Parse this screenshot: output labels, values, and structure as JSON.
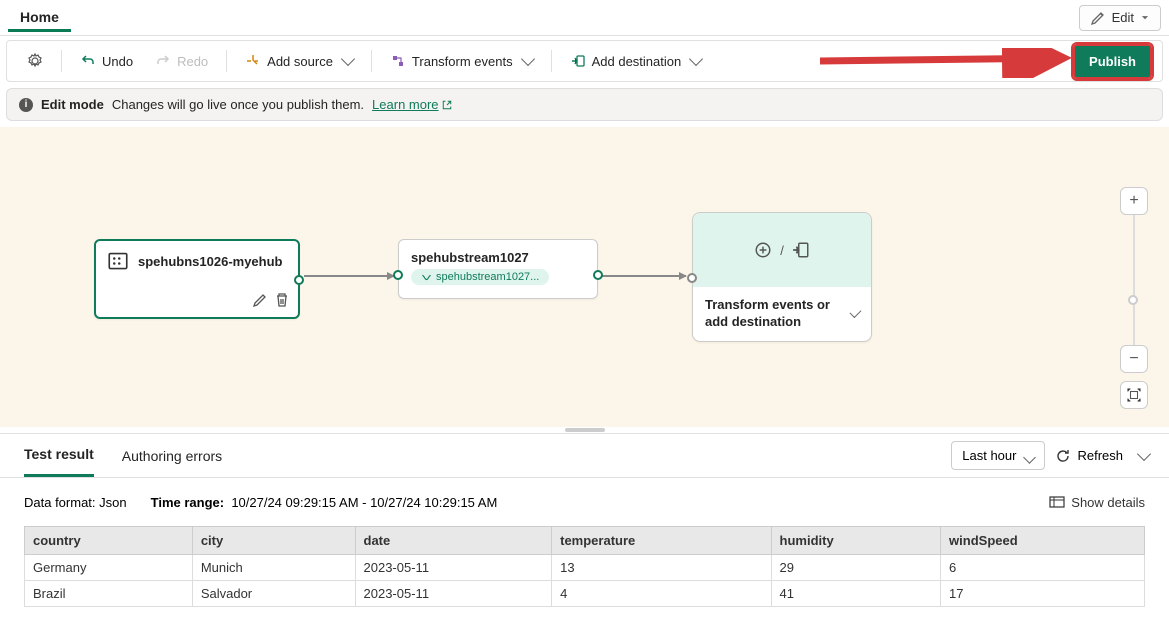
{
  "header": {
    "tab": "Home",
    "edit_label": "Edit"
  },
  "toolbar": {
    "undo": "Undo",
    "redo": "Redo",
    "add_source": "Add source",
    "transform": "Transform events",
    "add_dest": "Add destination",
    "publish": "Publish"
  },
  "edit_mode": {
    "title": "Edit mode",
    "msg": "Changes will go live once you publish them.",
    "learn": "Learn more"
  },
  "nodes": {
    "source_title": "spehubns1026-myehub",
    "stream_title": "spehubstream1027",
    "stream_pill": "spehubstream1027...",
    "dest_text": "Transform events or add destination"
  },
  "results": {
    "tab_test": "Test result",
    "tab_errors": "Authoring errors",
    "range_select": "Last hour",
    "refresh": "Refresh",
    "data_format_label": "Data format:",
    "data_format_val": "Json",
    "time_range_label": "Time range:",
    "time_range_val": "10/27/24 09:29:15 AM - 10/27/24 10:29:15 AM",
    "show_details": "Show details",
    "columns": [
      "country",
      "city",
      "date",
      "temperature",
      "humidity",
      "windSpeed"
    ],
    "rows": [
      {
        "country": "Germany",
        "city": "Munich",
        "date": "2023-05-11",
        "temperature": "13",
        "humidity": "29",
        "windSpeed": "6"
      },
      {
        "country": "Brazil",
        "city": "Salvador",
        "date": "2023-05-11",
        "temperature": "4",
        "humidity": "41",
        "windSpeed": "17"
      }
    ]
  }
}
